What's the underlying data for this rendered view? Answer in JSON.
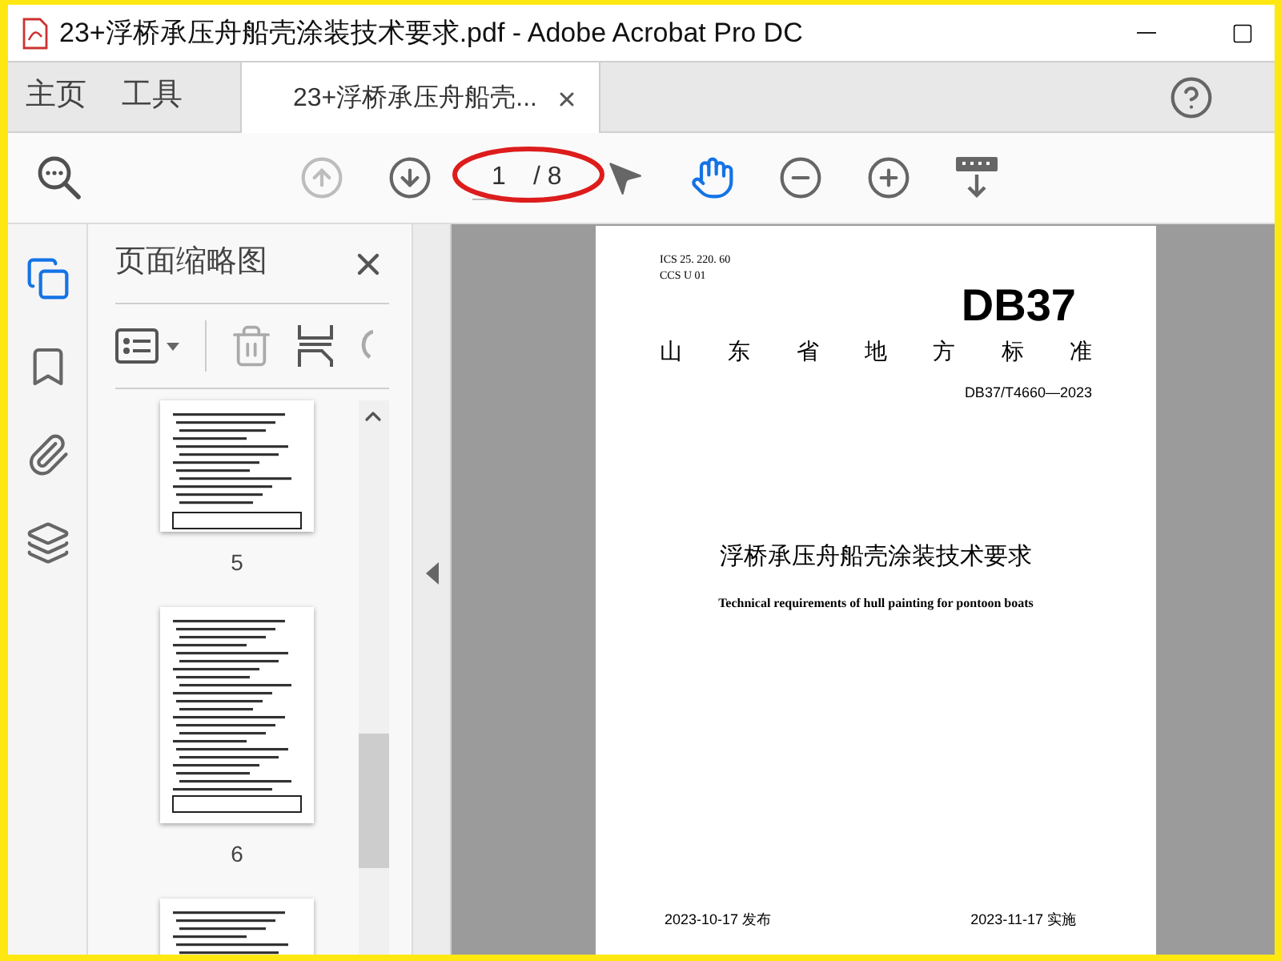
{
  "window": {
    "title": "23+浮桥承压舟船壳涂装技术要求.pdf - Adobe Acrobat Pro DC"
  },
  "nav_tabs": [
    {
      "label": "主页",
      "selected": false
    },
    {
      "label": "工具",
      "selected": false
    }
  ],
  "document_tab": {
    "label": "23+浮桥承压舟船壳...",
    "selected": true
  },
  "toolbar": {
    "tools": [
      {
        "kind": "prev",
        "disabled": true
      },
      {
        "kind": "next",
        "disabled": false
      },
      {
        "kind": "page"
      },
      {
        "kind": "select",
        "selected": false
      },
      {
        "kind": "hand",
        "selected": true
      },
      {
        "kind": "zoom_out"
      },
      {
        "kind": "zoom_in"
      },
      {
        "kind": "keyboard"
      }
    ],
    "page_number": "1",
    "page_total": "/ 8"
  },
  "left_rail": [
    {
      "kind": "pages",
      "selected": true
    },
    {
      "kind": "bookmarks",
      "selected": false
    },
    {
      "kind": "attachments",
      "selected": false
    },
    {
      "kind": "layers",
      "selected": false
    }
  ],
  "thumbnail_panel": {
    "title": "页面缩略图",
    "thumbnails": [
      {
        "kind": "short",
        "label": "5"
      },
      {
        "kind": "full",
        "label": "6"
      },
      {
        "kind": "full"
      }
    ]
  },
  "document_page": {
    "ics": "ICS  25. 220. 60",
    "ccs": "CCS  U 01",
    "logo": "DB37",
    "authority": [
      "山",
      "东",
      "省",
      "地",
      "方",
      "标",
      "准"
    ],
    "code": "DB37/T4660—2023",
    "title": "浮桥承压舟船壳涂装技术要求",
    "subtitle": "Technical requirements of hull painting for pontoon boats",
    "issued": "2023-10-17 发布",
    "effective": "2023-11-17 实施"
  }
}
